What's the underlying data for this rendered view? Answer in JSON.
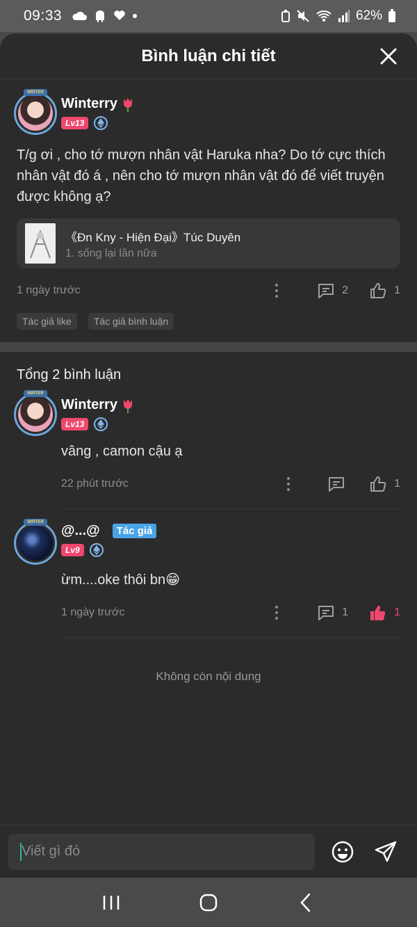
{
  "status": {
    "time": "09:33",
    "battery": "62%"
  },
  "sheet": {
    "title": "Bình luận chi tiết"
  },
  "main_comment": {
    "username": "Winterry",
    "level": "Lv13",
    "text": "T/g ơi , cho tớ mượn nhân vật Haruka nha? Do tớ cực thích nhân vật đó á , nên cho tớ mượn nhân vật đó để viết truyện được không ạ?",
    "book": {
      "title": "《Đn Kny - Hiện Đại》Túc Duyên",
      "chapter": "1. sống lại lần nữa"
    },
    "time": "1 ngày trước",
    "reply_count": "2",
    "like_count": "1",
    "tags": [
      "Tác giả like",
      "Tác giả bình luận"
    ]
  },
  "total_label": "Tổng 2 bình luận",
  "replies": [
    {
      "username": "Winterry",
      "level": "Lv13",
      "text": "vâng , camon cậu ạ",
      "time": "22 phút trước",
      "reply_count": "",
      "like_count": "1",
      "liked": false
    },
    {
      "username": "@...@",
      "author_tag": "Tác giả",
      "level": "Lv9",
      "text": "ừm....oke thôi bn😁",
      "time": "1 ngày trước",
      "reply_count": "1",
      "like_count": "1",
      "liked": true
    }
  ],
  "no_more": "Không còn nội dung",
  "input": {
    "placeholder": "Viết gì đó"
  },
  "colors": {
    "accent_pink": "#f0476e",
    "author_blue": "#4aa3e8",
    "sheet_bg": "#2b2b2b"
  }
}
